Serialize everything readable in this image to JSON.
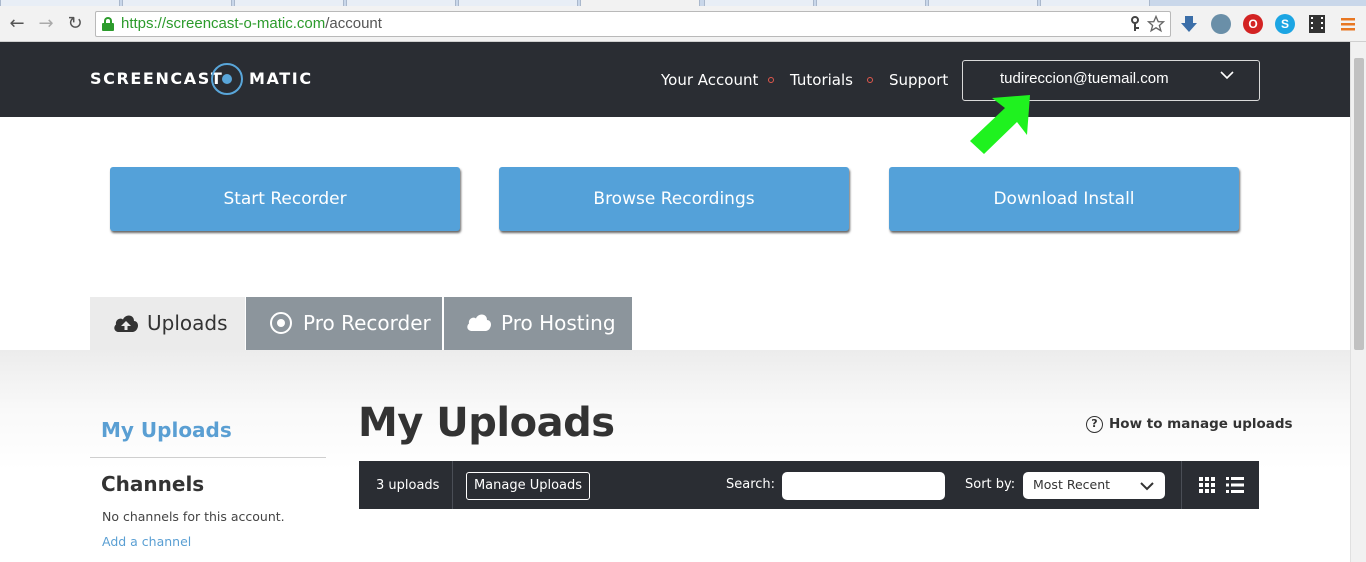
{
  "browser": {
    "url_host": "https://screencast-o-matic.com",
    "url_path": "/account",
    "back_glyph": "←",
    "forward_glyph": "→",
    "reload_glyph": "↻"
  },
  "header": {
    "logo_left": "SCREENCAST",
    "logo_right": "MATIC",
    "nav": [
      "Your Account",
      "Tutorials",
      "Support"
    ],
    "account_email": "tudireccion@tuemail.com",
    "accent_color": "#59a6da",
    "bg_color": "#2a2d33"
  },
  "actions": [
    "Start Recorder",
    "Browse Recordings",
    "Download Install"
  ],
  "tabs": [
    {
      "label": "Uploads",
      "icon": "cloud-upload-icon",
      "active": true
    },
    {
      "label": "Pro Recorder",
      "icon": "record-icon",
      "active": false
    },
    {
      "label": "Pro Hosting",
      "icon": "cloud-icon",
      "active": false
    }
  ],
  "sidebar": {
    "title": "My Uploads",
    "channels_heading": "Channels",
    "no_channels": "No channels for this account.",
    "add_channel": "Add a channel"
  },
  "main": {
    "title": "My Uploads",
    "help_link": "How to manage uploads",
    "help_glyph": "?",
    "toolbar": {
      "count": "3 uploads",
      "manage": "Manage Uploads",
      "search_label": "Search:",
      "search_value": "",
      "sort_label": "Sort by:",
      "sort_value": "Most Recent"
    }
  }
}
